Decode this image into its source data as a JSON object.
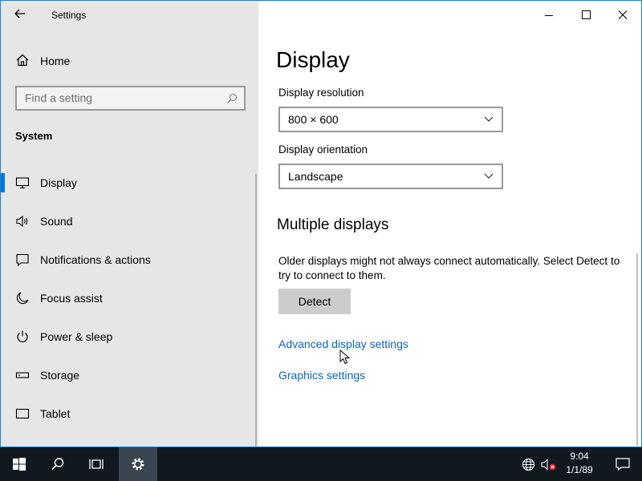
{
  "window": {
    "title": "Settings",
    "controls": {
      "minimize": "minimize-icon",
      "maximize": "maximize-icon",
      "close": "close-icon"
    }
  },
  "sidebar": {
    "home_label": "Home",
    "search_placeholder": "Find a setting",
    "section": "System",
    "items": [
      {
        "label": "Display",
        "icon": "monitor-icon",
        "selected": true
      },
      {
        "label": "Sound",
        "icon": "speaker-icon",
        "selected": false
      },
      {
        "label": "Notifications & actions",
        "icon": "notification-icon",
        "selected": false
      },
      {
        "label": "Focus assist",
        "icon": "moon-icon",
        "selected": false
      },
      {
        "label": "Power & sleep",
        "icon": "power-icon",
        "selected": false
      },
      {
        "label": "Storage",
        "icon": "storage-icon",
        "selected": false
      },
      {
        "label": "Tablet",
        "icon": "tablet-icon",
        "selected": false
      }
    ]
  },
  "main": {
    "title": "Display",
    "resolution_label": "Display resolution",
    "resolution_value": "800 × 600",
    "orientation_label": "Display orientation",
    "orientation_value": "Landscape",
    "multiple_heading": "Multiple displays",
    "multiple_desc": "Older displays might not always connect automatically. Select Detect to try to connect to them.",
    "detect_button": "Detect",
    "advanced_link": "Advanced display settings",
    "graphics_link": "Graphics settings"
  },
  "taskbar": {
    "buttons": [
      "windows-start-icon",
      "search-icon",
      "task-view-icon",
      "settings-gear-icon"
    ],
    "tray_icons": [
      "network-globe-icon",
      "volume-muted-icon"
    ],
    "time": "9:04",
    "date": "1/1/89",
    "notifications_icon": "action-center-icon"
  },
  "colors": {
    "accent": "#0078d7",
    "link": "#0a66b8",
    "sidebar_bg": "#e6e6e6",
    "taskbar_bg": "#101820"
  }
}
